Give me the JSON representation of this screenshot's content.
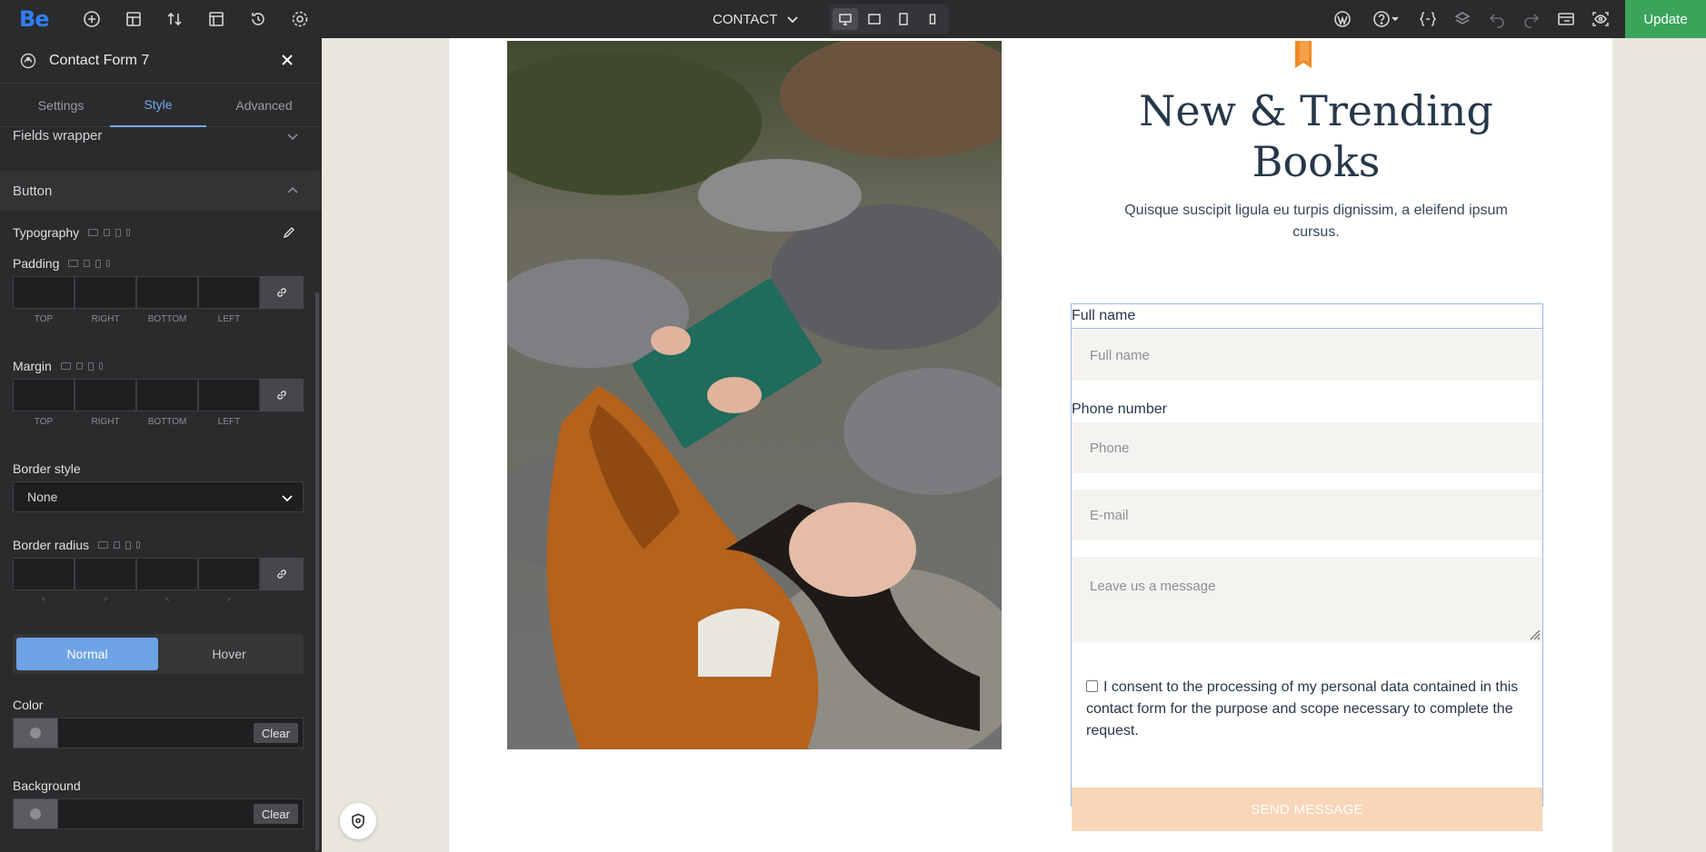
{
  "topbar": {
    "logo": "Be",
    "page_name": "CONTACT",
    "update_label": "Update",
    "icons": [
      "add-icon",
      "layout-icon",
      "sort-icon",
      "template-icon",
      "history-icon",
      "settings-icon",
      "wordpress-icon",
      "help-icon",
      "custom-code-icon",
      "layers-icon",
      "undo-icon",
      "redo-icon",
      "preview-icon",
      "eye-settings-icon"
    ],
    "devices": [
      "desktop",
      "tablet-landscape",
      "tablet-portrait",
      "mobile"
    ]
  },
  "panel": {
    "title": "Contact Form 7",
    "tabs": [
      "Settings",
      "Style",
      "Advanced"
    ],
    "active_tab": "Style",
    "sections": {
      "fields_wrapper": "Fields wrapper",
      "button": "Button"
    },
    "typography_label": "Typography",
    "padding_label": "Padding",
    "margin_label": "Margin",
    "quad_labels": [
      "TOP",
      "RIGHT",
      "BOTTOM",
      "LEFT"
    ],
    "border_style_label": "Border style",
    "border_style_value": "None",
    "border_radius_label": "Border radius",
    "radius_labels": [
      "⸌",
      "⸍",
      "⸌",
      "⸍"
    ],
    "state_normal": "Normal",
    "state_hover": "Hover",
    "color_label": "Color",
    "background_label": "Background",
    "clear_label": "Clear"
  },
  "canvas": {
    "headline": "New & Trending Books",
    "subline": "Quisque suscipit ligula eu turpis dignissim, a eleifend ipsum cursus.",
    "form": {
      "full_name_label": "Full name",
      "full_name_placeholder": "Full name",
      "phone_label": "Phone number",
      "phone_placeholder": "Phone",
      "email_placeholder": "E-mail",
      "message_placeholder": "Leave us a message",
      "consent": "I consent to the processing of my personal data contained in this contact form for the purpose and scope necessary to complete the request.",
      "send_label": "SEND MESSAGE"
    }
  },
  "colors": {
    "accent": "#6ea3e6",
    "update_green": "#3aa55a",
    "headline": "#26374a",
    "send_button": "#f8d6b8",
    "bookmark": "#f08a24"
  }
}
